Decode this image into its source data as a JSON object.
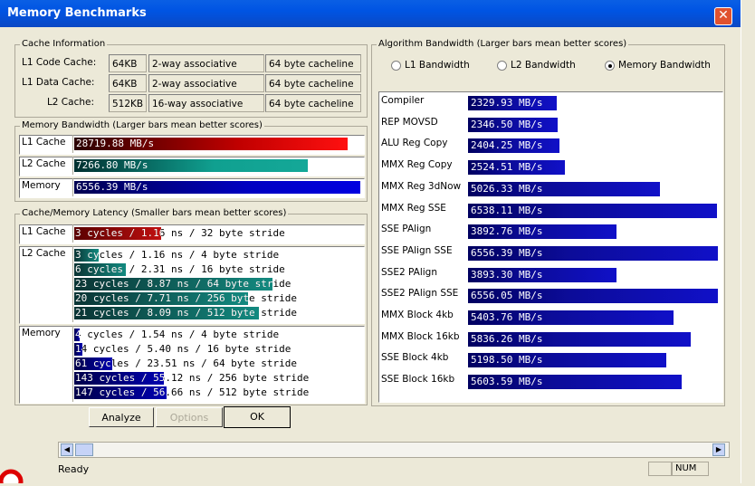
{
  "window": {
    "title": "Memory Benchmarks",
    "close": "✕"
  },
  "cache_info": {
    "title": "Cache Information",
    "rows": [
      {
        "label": "L1 Code Cache:",
        "size": "64KB",
        "assoc": "2-way associative",
        "line": "64 byte cacheline"
      },
      {
        "label": "L1 Data Cache:",
        "size": "64KB",
        "assoc": "2-way associative",
        "line": "64 byte cacheline"
      },
      {
        "label": "L2 Cache:",
        "size": "512KB",
        "assoc": "16-way associative",
        "line": "64 byte cacheline"
      }
    ]
  },
  "mem_bw": {
    "title": "Memory Bandwidth (Larger bars mean better scores)",
    "rows": [
      {
        "label": "L1 Cache",
        "text": "28719.88 MB/s",
        "fill": 0.955
      },
      {
        "label": "L2 Cache",
        "text": "7266.80 MB/s",
        "fill": 0.815
      },
      {
        "label": "Memory",
        "text": "6556.39 MB/s",
        "fill": 1.0
      }
    ]
  },
  "latency": {
    "title": "Cache/Memory Latency (Smaller bars mean better scores)",
    "groups": [
      {
        "label": "L1 Cache",
        "rows": [
          {
            "text": "3 cycles / 1.16 ns / 32 byte stride",
            "fill": 0.32
          }
        ]
      },
      {
        "label": "L2 Cache",
        "rows": [
          {
            "text": "3 cycles / 1.16 ns / 4 byte stride",
            "fill": 0.09
          },
          {
            "text": "6 cycles / 2.31 ns / 16 byte stride",
            "fill": 0.19
          },
          {
            "text": "23 cycles / 8.87 ns / 64 byte stride",
            "fill": 0.73
          },
          {
            "text": "20 cycles / 7.71 ns / 256 byte stride",
            "fill": 0.64
          },
          {
            "text": "21 cycles / 8.09 ns / 512 byte stride",
            "fill": 0.68
          }
        ]
      },
      {
        "label": "Memory",
        "rows": [
          {
            "text": "4 cycles / 1.54 ns / 4 byte stride",
            "fill": 0.02
          },
          {
            "text": "14 cycles / 5.40 ns / 16 byte stride",
            "fill": 0.03
          },
          {
            "text": "61 cycles / 23.51 ns / 64 byte stride",
            "fill": 0.14
          },
          {
            "text": "143 cycles / 55.12 ns / 256 byte stride",
            "fill": 0.33
          },
          {
            "text": "147 cycles / 56.66 ns / 512 byte stride",
            "fill": 0.34
          }
        ]
      }
    ]
  },
  "buttons": {
    "analyze": "Analyze",
    "options": "Options",
    "ok": "OK"
  },
  "algo": {
    "title": "Algorithm Bandwidth (Larger bars mean better scores)",
    "radios": [
      {
        "label": "L1 Bandwidth",
        "selected": false
      },
      {
        "label": "L2 Bandwidth",
        "selected": false
      },
      {
        "label": "Memory Bandwidth",
        "selected": true
      }
    ],
    "rows": [
      {
        "label": "Compiler",
        "text": "2329.93 MB/s",
        "fill": 0.356
      },
      {
        "label": "REP MOVSD",
        "text": "2346.50 MB/s",
        "fill": 0.359
      },
      {
        "label": "ALU Reg Copy",
        "text": "2404.25 MB/s",
        "fill": 0.367
      },
      {
        "label": "MMX Reg Copy",
        "text": "2524.51 MB/s",
        "fill": 0.386
      },
      {
        "label": "MMX Reg 3dNow",
        "text": "5026.33 MB/s",
        "fill": 0.767
      },
      {
        "label": "MMX Reg SSE",
        "text": "6538.11 MB/s",
        "fill": 0.997
      },
      {
        "label": "SSE PAlign",
        "text": "3892.76 MB/s",
        "fill": 0.594
      },
      {
        "label": "SSE PAlign SSE",
        "text": "6556.39 MB/s",
        "fill": 1.0
      },
      {
        "label": "SSE2 PAlign",
        "text": "3893.30 MB/s",
        "fill": 0.594
      },
      {
        "label": "SSE2 PAlign SSE",
        "text": "6556.05 MB/s",
        "fill": 1.0
      },
      {
        "label": "MMX Block 4kb",
        "text": "5403.76 MB/s",
        "fill": 0.824
      },
      {
        "label": "MMX Block 16kb",
        "text": "5836.26 MB/s",
        "fill": 0.89
      },
      {
        "label": "SSE Block 4kb",
        "text": "5198.50 MB/s",
        "fill": 0.793
      },
      {
        "label": "SSE Block 16kb",
        "text": "5603.59 MB/s",
        "fill": 0.855
      }
    ]
  },
  "statusbar": {
    "status": "Ready",
    "num": "NUM"
  },
  "colors": {
    "l1": "#c00000",
    "l2": "#10a090",
    "mem": "#0000c0",
    "dark_l2": "#0e5a58",
    "algo": "#0c0c98"
  }
}
